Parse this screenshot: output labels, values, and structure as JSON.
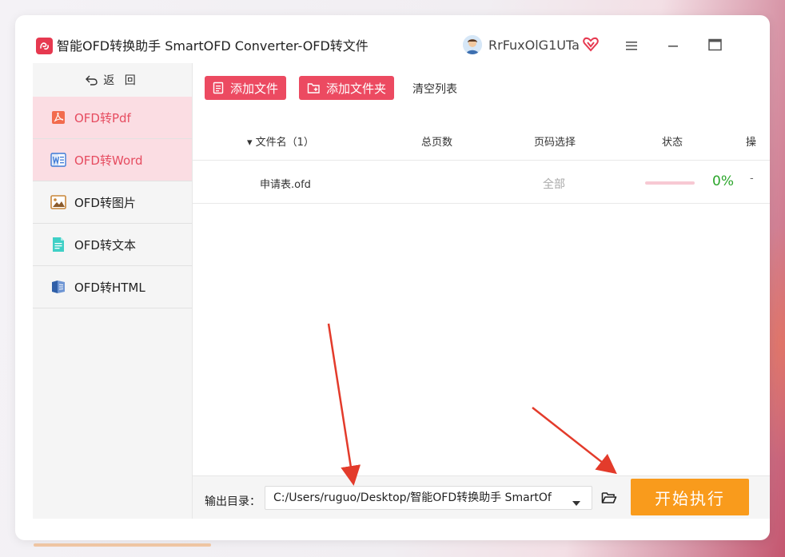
{
  "app": {
    "title": "智能OFD转换助手 SmartOFD Converter-OFD转文件",
    "username": "RrFuxOlG1UTa"
  },
  "sidebar": {
    "back_label": "返 回",
    "items": [
      {
        "label": "OFD转Pdf",
        "icon": "pdf-icon"
      },
      {
        "label": "OFD转Word",
        "icon": "word-icon"
      },
      {
        "label": "OFD转图片",
        "icon": "image-icon"
      },
      {
        "label": "OFD转文本",
        "icon": "text-icon"
      },
      {
        "label": "OFD转HTML",
        "icon": "html-icon"
      }
    ]
  },
  "toolbar": {
    "add_file": "添加文件",
    "add_folder": "添加文件夹",
    "clear_list": "清空列表"
  },
  "table": {
    "headers": {
      "filename": "▾ 文件名（1）",
      "pages": "总页数",
      "page_select": "页码选择",
      "status": "状态",
      "op": "操"
    },
    "rows": [
      {
        "filename": "申请表.ofd",
        "pages": "",
        "page_select": "全部",
        "progress": 0.0,
        "progress_text": "0%",
        "op": "-"
      }
    ]
  },
  "output": {
    "label": "输出目录：",
    "path": "C:/Users/ruguo/Desktop/智能OFD转换助手 SmartOf",
    "start_button": "开始执行"
  },
  "colors": {
    "accent": "#ec4a61",
    "start": "#f99b1c",
    "progress_text": "#2aa52a",
    "arrow": "#e33b2b"
  }
}
